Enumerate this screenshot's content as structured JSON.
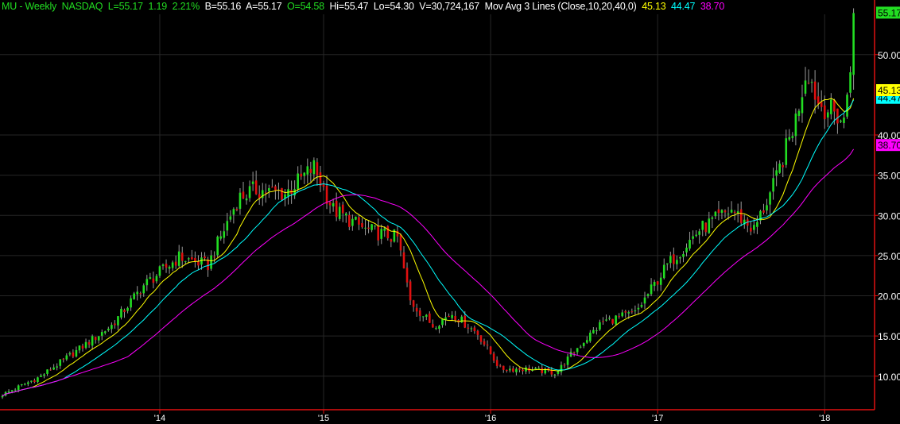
{
  "header": {
    "symbol": "MU - Weekly",
    "exchange": "NASDAQ",
    "last": "L=55.17",
    "change": "1.19",
    "change_pct": "2.21%",
    "bid": "B=55.16",
    "ask": "A=55.17",
    "open": "O=54.58",
    "high": "Hi=55.47",
    "low": "Lo=54.30",
    "volume": "V=30,724,167",
    "indicator": "Mov Avg 3 Lines (Close,10,20,40,0)",
    "ma_values": [
      "45.13",
      "44.47",
      "38.70"
    ]
  },
  "chart_data": {
    "type": "candlestick",
    "title": "MU - Weekly",
    "x_tick_labels": [
      "'14",
      "'15",
      "'16",
      "'17",
      "'18"
    ],
    "x_tick_weeks": [
      49,
      100,
      152,
      204,
      256
    ],
    "y_tick_labels": [
      "10.00",
      "15.00",
      "20.00",
      "25.00",
      "30.00",
      "35.00",
      "40.00",
      "50.00"
    ],
    "y_ticks": [
      10,
      15,
      20,
      25,
      30,
      35,
      40,
      50
    ],
    "ylim": [
      7,
      57
    ],
    "grid": true,
    "close_keyframes": [
      [
        0,
        7.7
      ],
      [
        11.6,
        9.9
      ],
      [
        24,
        13.4
      ],
      [
        34,
        16.3
      ],
      [
        44,
        21.3
      ],
      [
        55,
        24.8
      ],
      [
        64,
        23.8
      ],
      [
        73.5,
        32.2
      ],
      [
        78.5,
        33.2
      ],
      [
        88,
        32.7
      ],
      [
        97,
        36
      ],
      [
        103,
        30.7
      ],
      [
        113,
        28.2
      ],
      [
        123,
        27.2
      ],
      [
        127,
        19.3
      ],
      [
        134,
        16.3
      ],
      [
        140,
        17.8
      ],
      [
        148,
        15.3
      ],
      [
        155,
        10.9
      ],
      [
        163,
        10.9
      ],
      [
        172.5,
        10.4
      ],
      [
        177.5,
        12.9
      ],
      [
        187,
        16.8
      ],
      [
        197,
        17.8
      ],
      [
        207,
        23.8
      ],
      [
        217,
        28.2
      ],
      [
        227,
        30.7
      ],
      [
        234,
        28.2
      ],
      [
        240.5,
        34
      ],
      [
        247,
        42
      ],
      [
        250.5,
        48.5
      ],
      [
        254,
        44
      ],
      [
        259,
        42.7
      ],
      [
        262,
        41.6
      ],
      [
        264,
        49
      ],
      [
        265,
        55.17
      ]
    ],
    "moving_averages": [
      {
        "name": "MA10",
        "period": 10,
        "color": "#ffff00",
        "last": "45.13"
      },
      {
        "name": "MA20",
        "period": 20,
        "color": "#00ffff",
        "last": "44.47"
      },
      {
        "name": "MA40",
        "period": 40,
        "color": "#ff00ff",
        "last": "38.70"
      }
    ],
    "last_price": {
      "value": 55.17,
      "label": "55.17",
      "color": "#22dd22"
    },
    "up_color": "#22dd22",
    "down_color": "#e01010"
  }
}
